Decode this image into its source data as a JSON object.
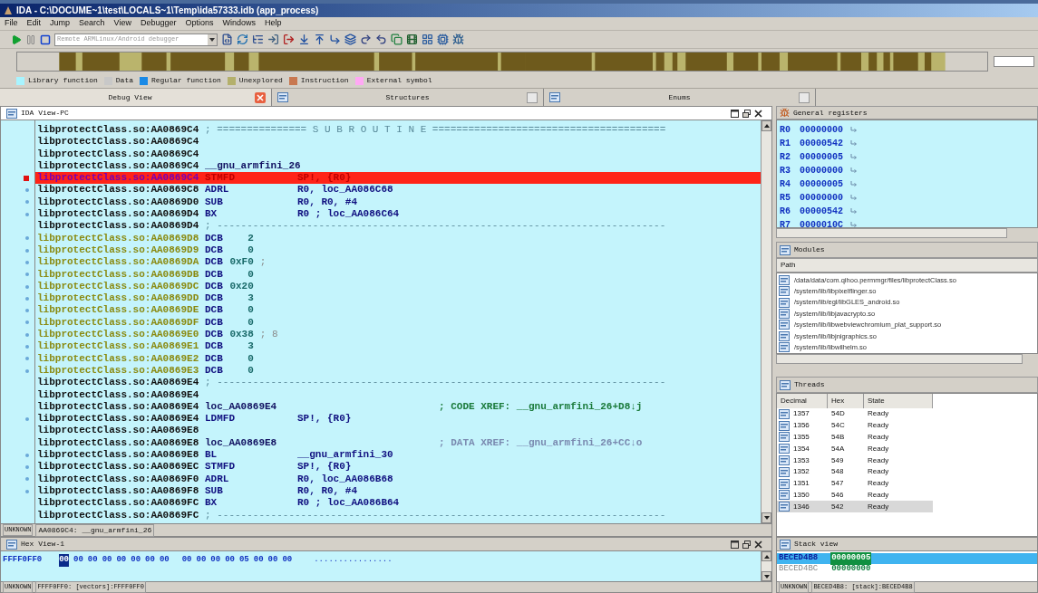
{
  "window": {
    "title": "IDA - C:\\DOCUME~1\\test\\LOCALS~1\\Temp\\ida57333.idb (app_process)"
  },
  "menu": [
    "File",
    "Edit",
    "Jump",
    "Search",
    "View",
    "Debugger",
    "Options",
    "Windows",
    "Help"
  ],
  "toolbar": {
    "debugger_select": "Remote ARMLinux/Android debugger"
  },
  "legend": [
    {
      "label": "Library function",
      "color": "#a8f4ff"
    },
    {
      "label": "Data",
      "color": "#c8c8c8"
    },
    {
      "label": "Regular function",
      "color": "#1a8ae6"
    },
    {
      "label": "Unexplored",
      "color": "#b4b06c"
    },
    {
      "label": "Instruction",
      "color": "#c87850"
    },
    {
      "label": "External symbol",
      "color": "#ffa8f4"
    }
  ],
  "tabs": [
    {
      "label": "Debug View",
      "selected": true
    },
    {
      "label": "Structures",
      "selected": false
    },
    {
      "label": "Enums",
      "selected": false
    }
  ],
  "ida_view": {
    "title": "IDA View-PC",
    "lines": [
      {
        "addr": "libprotectClass.so:AA0869C4",
        "kind": "separator",
        "text": "; =============== S U B R O U T I N E =======================================",
        "breakpoint": false,
        "traced": false
      },
      {
        "addr": "libprotectClass.so:AA0869C4",
        "kind": "blank",
        "breakpoint": false,
        "traced": false
      },
      {
        "addr": "libprotectClass.so:AA0869C4",
        "kind": "blank",
        "breakpoint": false,
        "traced": false
      },
      {
        "addr": "libprotectClass.so:AA0869C4",
        "kind": "label",
        "text": "__gnu_armfini_26",
        "breakpoint": false,
        "traced": false
      },
      {
        "addr": "libprotectClass.so:AA0869C4",
        "kind": "code",
        "mnem": "STMFD",
        "ops": "SP!, {R0}",
        "breakpoint": true,
        "traced": false
      },
      {
        "addr": "libprotectClass.so:AA0869C8",
        "kind": "code",
        "mnem": "ADRL",
        "ops": "R0, loc_AA086C68",
        "breakpoint": false,
        "traced": true
      },
      {
        "addr": "libprotectClass.so:AA0869D0",
        "kind": "code",
        "mnem": "SUB",
        "ops": "R0, R0, #4",
        "breakpoint": false,
        "traced": true
      },
      {
        "addr": "libprotectClass.so:AA0869D4",
        "kind": "code",
        "mnem": "BX",
        "ops": "R0 ; loc_AA086C64",
        "breakpoint": false,
        "traced": true
      },
      {
        "addr": "libprotectClass.so:AA0869D4",
        "kind": "separator",
        "text": "; ---------------------------------------------------------------------------",
        "breakpoint": false,
        "traced": false
      },
      {
        "addr": "libprotectClass.so:AA0869D8",
        "kind": "data",
        "mnem": "DCB",
        "ops": "2",
        "breakpoint": false,
        "traced": true
      },
      {
        "addr": "libprotectClass.so:AA0869D9",
        "kind": "data",
        "mnem": "DCB",
        "ops": "0",
        "breakpoint": false,
        "traced": true
      },
      {
        "addr": "libprotectClass.so:AA0869DA",
        "kind": "data",
        "mnem": "DCB",
        "ops": "0xF0",
        "comment": ";",
        "breakpoint": false,
        "traced": true
      },
      {
        "addr": "libprotectClass.so:AA0869DB",
        "kind": "data",
        "mnem": "DCB",
        "ops": "0",
        "breakpoint": false,
        "traced": true
      },
      {
        "addr": "libprotectClass.so:AA0869DC",
        "kind": "data",
        "mnem": "DCB",
        "ops": "0x20",
        "breakpoint": false,
        "traced": true
      },
      {
        "addr": "libprotectClass.so:AA0869DD",
        "kind": "data",
        "mnem": "DCB",
        "ops": "3",
        "breakpoint": false,
        "traced": true
      },
      {
        "addr": "libprotectClass.so:AA0869DE",
        "kind": "data",
        "mnem": "DCB",
        "ops": "0",
        "breakpoint": false,
        "traced": true
      },
      {
        "addr": "libprotectClass.so:AA0869DF",
        "kind": "data",
        "mnem": "DCB",
        "ops": "0",
        "breakpoint": false,
        "traced": true
      },
      {
        "addr": "libprotectClass.so:AA0869E0",
        "kind": "data",
        "mnem": "DCB",
        "ops": "0x38",
        "comment": "; 8",
        "breakpoint": false,
        "traced": true
      },
      {
        "addr": "libprotectClass.so:AA0869E1",
        "kind": "data",
        "mnem": "DCB",
        "ops": "3",
        "breakpoint": false,
        "traced": true
      },
      {
        "addr": "libprotectClass.so:AA0869E2",
        "kind": "data",
        "mnem": "DCB",
        "ops": "0",
        "breakpoint": false,
        "traced": true
      },
      {
        "addr": "libprotectClass.so:AA0869E3",
        "kind": "data",
        "mnem": "DCB",
        "ops": "0",
        "breakpoint": false,
        "traced": true
      },
      {
        "addr": "libprotectClass.so:AA0869E4",
        "kind": "separator",
        "text": "; ---------------------------------------------------------------------------",
        "breakpoint": false,
        "traced": false
      },
      {
        "addr": "libprotectClass.so:AA0869E4",
        "kind": "blank",
        "breakpoint": false,
        "traced": false
      },
      {
        "addr": "libprotectClass.so:AA0869E4",
        "kind": "label",
        "text": "loc_AA0869E4",
        "xref": {
          "kind": "code",
          "text": "; CODE XREF: __gnu_armfini_26+D8↓j"
        },
        "breakpoint": false,
        "traced": false
      },
      {
        "addr": "libprotectClass.so:AA0869E4",
        "kind": "code",
        "mnem": "LDMFD",
        "ops": "SP!, {R0}",
        "breakpoint": false,
        "traced": true
      },
      {
        "addr": "libprotectClass.so:AA0869E8",
        "kind": "blank",
        "breakpoint": false,
        "traced": false
      },
      {
        "addr": "libprotectClass.so:AA0869E8",
        "kind": "label",
        "text": "loc_AA0869E8",
        "xref": {
          "kind": "data",
          "text": "; DATA XREF: __gnu_armfini_26+CC↓o"
        },
        "breakpoint": false,
        "traced": false
      },
      {
        "addr": "libprotectClass.so:AA0869E8",
        "kind": "code",
        "mnem": "BL",
        "ops": "__gnu_armfini_30",
        "breakpoint": false,
        "traced": true
      },
      {
        "addr": "libprotectClass.so:AA0869EC",
        "kind": "code",
        "mnem": "STMFD",
        "ops": "SP!, {R0}",
        "breakpoint": false,
        "traced": true
      },
      {
        "addr": "libprotectClass.so:AA0869F0",
        "kind": "code",
        "mnem": "ADRL",
        "ops": "R0, loc_AA086B68",
        "breakpoint": false,
        "traced": true
      },
      {
        "addr": "libprotectClass.so:AA0869F8",
        "kind": "code",
        "mnem": "SUB",
        "ops": "R0, R0, #4",
        "breakpoint": false,
        "traced": true
      },
      {
        "addr": "libprotectClass.so:AA0869FC",
        "kind": "code",
        "mnem": "BX",
        "ops": "R0 ; loc_AA086B64",
        "breakpoint": false,
        "traced": false
      },
      {
        "addr": "libprotectClass.so:AA0869FC",
        "kind": "separator",
        "text": "; ---------------------------------------------------------------------------",
        "breakpoint": false,
        "traced": false
      }
    ],
    "status": {
      "type": "UNKNOWN",
      "location": "AA0869C4: __gnu_armfini_26"
    }
  },
  "registers": {
    "title": "General registers",
    "items": [
      {
        "name": "R0",
        "value": "00000000"
      },
      {
        "name": "R1",
        "value": "00000542"
      },
      {
        "name": "R2",
        "value": "00000005"
      },
      {
        "name": "R3",
        "value": "00000000"
      },
      {
        "name": "R4",
        "value": "00000005"
      },
      {
        "name": "R5",
        "value": "00000000"
      },
      {
        "name": "R6",
        "value": "00000542"
      },
      {
        "name": "R7",
        "value": "0000010C"
      }
    ]
  },
  "modules": {
    "title": "Modules",
    "column": "Path",
    "items": [
      "/data/data/com.qihoo.permmgr/files/libprotectClass.so",
      "/system/lib/libpixelflinger.so",
      "/system/lib/egl/libGLES_android.so",
      "/system/lib/libjavacrypto.so",
      "/system/lib/libwebviewchromium_plat_support.so",
      "/system/lib/libjnigraphics.so",
      "/system/lib/libwilhelm.so"
    ]
  },
  "threads": {
    "title": "Threads",
    "columns": [
      "Decimal",
      "Hex",
      "State"
    ],
    "rows": [
      {
        "decimal": "1357",
        "hex": "54D",
        "state": "Ready",
        "selected": false
      },
      {
        "decimal": "1356",
        "hex": "54C",
        "state": "Ready",
        "selected": false
      },
      {
        "decimal": "1355",
        "hex": "54B",
        "state": "Ready",
        "selected": false
      },
      {
        "decimal": "1354",
        "hex": "54A",
        "state": "Ready",
        "selected": false
      },
      {
        "decimal": "1353",
        "hex": "549",
        "state": "Ready",
        "selected": false
      },
      {
        "decimal": "1352",
        "hex": "548",
        "state": "Ready",
        "selected": false
      },
      {
        "decimal": "1351",
        "hex": "547",
        "state": "Ready",
        "selected": false
      },
      {
        "decimal": "1350",
        "hex": "546",
        "state": "Ready",
        "selected": false
      },
      {
        "decimal": "1346",
        "hex": "542",
        "state": "Ready",
        "selected": true
      }
    ]
  },
  "hex_view": {
    "title": "Hex View-1",
    "address": "FFFF0FF0",
    "bytes": [
      {
        "value": "00",
        "selected": true
      },
      {
        "value": "00",
        "selected": false
      },
      {
        "value": "00",
        "selected": false
      },
      {
        "value": "00",
        "selected": false
      },
      {
        "value": "00",
        "selected": false
      },
      {
        "value": "00",
        "selected": false
      },
      {
        "value": "00",
        "selected": false
      },
      {
        "value": "00",
        "selected": false
      },
      {
        "value": "00",
        "selected": false
      },
      {
        "value": "00",
        "selected": false
      },
      {
        "value": "00",
        "selected": false
      },
      {
        "value": "00",
        "selected": false
      },
      {
        "value": "05",
        "selected": false
      },
      {
        "value": "00",
        "selected": false
      },
      {
        "value": "00",
        "selected": false
      },
      {
        "value": "00",
        "selected": false
      }
    ],
    "ascii": "................",
    "status": {
      "type": "UNKNOWN",
      "location": "FFFF0FF0: [vectors]:FFFF0FF0"
    }
  },
  "stack_view": {
    "title": "Stack view",
    "rows": [
      {
        "address": "BECED4B8",
        "value": "00000005",
        "selected": true
      },
      {
        "address": "BECED4BC",
        "value": "00000000",
        "selected": false
      }
    ],
    "status": {
      "type": "UNKNOWN",
      "location": "BECED4B8: [stack]:BECED4B8"
    }
  }
}
